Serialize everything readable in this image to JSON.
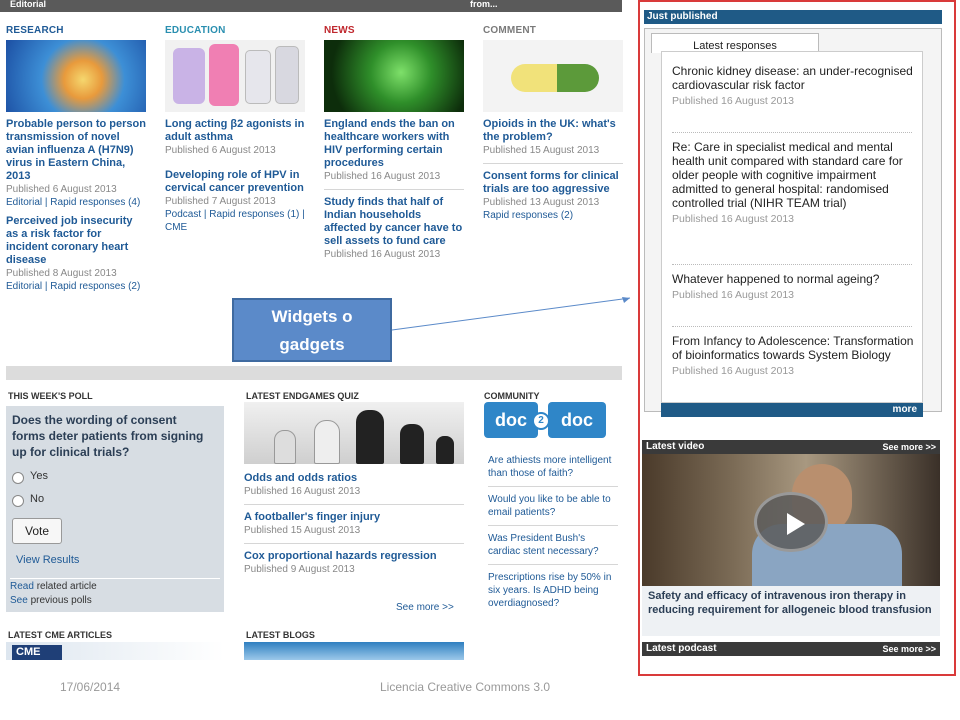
{
  "topbar": {
    "left_label": "Editorial",
    "right_label": "from..."
  },
  "research": {
    "category": "Research",
    "articles": [
      {
        "title": "Probable person to person transmission of novel avian influenza A (H7N9) virus in Eastern China, 2013",
        "published": "Published 6 August 2013",
        "links": "Editorial | Rapid responses (4)"
      },
      {
        "title": "Perceived job insecurity as a risk factor for incident coronary heart disease",
        "published": "Published 8 August 2013",
        "links": "Editorial | Rapid responses (2)"
      }
    ]
  },
  "education": {
    "category": "Education",
    "articles": [
      {
        "title": "Long acting β2 agonists in adult asthma",
        "published": "Published 6 August 2013"
      },
      {
        "title": "Developing role of HPV in cervical cancer prevention",
        "published": "Published 7 August 2013",
        "links": "Podcast | Rapid responses (1) | CME"
      }
    ]
  },
  "news": {
    "category": "News",
    "articles": [
      {
        "title": "England ends the ban on healthcare workers with HIV performing certain procedures",
        "published": "Published 16 August 2013"
      },
      {
        "title": "Study finds that half of Indian households affected by cancer have to sell assets to fund care",
        "published": "Published 16 August 2013"
      }
    ]
  },
  "comment": {
    "category": "Comment",
    "articles": [
      {
        "title": "Opioids in the UK: what's the problem?",
        "published": "Published 15 August 2013"
      },
      {
        "title": "Consent forms for clinical trials are too aggressive",
        "published": "Published 13 August 2013",
        "links": "Rapid responses (2)"
      }
    ]
  },
  "poll": {
    "heading": "This week's poll",
    "question": "Does the wording of consent forms deter patients from signing up for clinical trials?",
    "options": [
      "Yes",
      "No"
    ],
    "vote_label": "Vote",
    "view_results": "View Results",
    "read_prefix": "Read",
    "read_suffix": "related article",
    "see_prefix": "See",
    "see_suffix": "previous polls"
  },
  "quiz": {
    "heading": "Latest endgames quiz",
    "items": [
      {
        "title": "Odds and odds ratios",
        "published": "Published 16 August 2013"
      },
      {
        "title": "A footballer's finger injury",
        "published": "Published 15 August 2013"
      },
      {
        "title": "Cox proportional hazards regression",
        "published": "Published 9 August 2013"
      }
    ],
    "see_more": "See more >>"
  },
  "community": {
    "heading": "Community",
    "logo_left": "doc",
    "logo_mid": "2",
    "logo_right": "doc",
    "items": [
      "Are athiests more intelligent than those of faith?",
      "Would you like to be able to email patients?",
      "Was President Bush's cardiac stent necessary?",
      "Prescriptions rise by 50% in six years. Is ADHD being overdiagnosed?"
    ]
  },
  "bottom_heads": {
    "cme": "Latest CME articles",
    "blogs": "Latest blogs",
    "cme_logo": "CME"
  },
  "callout": {
    "line1": "Widgets o",
    "line2": "gadgets"
  },
  "right": {
    "just_published": "Just published",
    "tab_label": "Latest responses",
    "responses": [
      {
        "title": "Chronic kidney disease: an under-recognised cardiovascular risk factor",
        "published": "Published 16 August 2013"
      },
      {
        "title": "Re: Care in specialist medical and mental health unit compared with standard care for older people with cognitive impairment admitted to general hospital: randomised controlled trial (NIHR TEAM trial)",
        "published": "Published 16 August 2013"
      },
      {
        "title": "Whatever happened to normal ageing?",
        "published": "Published 16 August 2013"
      },
      {
        "title": "From Infancy to Adolescence: Transformation of bioinformatics towards System Biology",
        "published": "Published 16 August 2013"
      }
    ],
    "more_label": "more",
    "latest_video": "Latest video",
    "see_more": "See more >>",
    "video_caption": "Safety and efficacy of intravenous iron therapy in reducing requirement for allogeneic blood transfusion",
    "latest_podcast": "Latest podcast"
  },
  "footer": {
    "date": "17/06/2014",
    "license": "Licencia Creative Commons 3.0"
  },
  "colors": {
    "accent_blue": "#1f5a96",
    "panel_border": "#d93a3a",
    "callout": "#5b8ac9"
  }
}
